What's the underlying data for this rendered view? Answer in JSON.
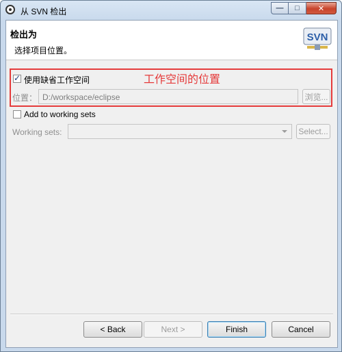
{
  "window": {
    "title": "从 SVN 检出"
  },
  "banner": {
    "title": "检出为",
    "description": "选择项目位置。"
  },
  "workspace": {
    "use_default_label": "使用缺省工作空间",
    "use_default_checked": true,
    "location_label": "位置：",
    "location_value": "D:/workspace/eclipse",
    "browse_label": "浏览..."
  },
  "working_sets": {
    "add_label": "Add to working sets",
    "add_checked": false,
    "label": "Working sets:",
    "value": "",
    "select_label": "Select..."
  },
  "annotation": {
    "text": "工作空间的位置",
    "color": "#e53a3a"
  },
  "footer": {
    "back": "< Back",
    "next": "Next >",
    "finish": "Finish",
    "cancel": "Cancel"
  },
  "logo": {
    "text": "SVN"
  }
}
